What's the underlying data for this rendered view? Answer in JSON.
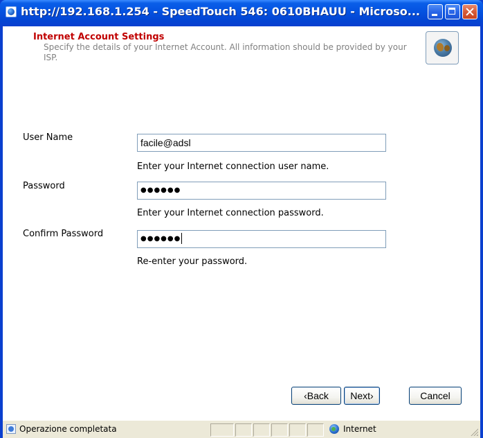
{
  "window": {
    "title": "http://192.168.1.254 - SpeedTouch 546:  0610BHAUU - Microso..."
  },
  "header": {
    "title": "Internet Account Settings",
    "description": "Specify the details of your Internet Account. All information should be provided by your ISP.",
    "icon": "globe-icon"
  },
  "form": {
    "username": {
      "label": "User Name",
      "value": "facile@adsl",
      "hint": "Enter your Internet connection user name."
    },
    "password": {
      "label": "Password",
      "value": "●●●●●●",
      "hint": "Enter your Internet connection password."
    },
    "confirm_password": {
      "label": "Confirm Password",
      "value": "●●●●●●",
      "hint": "Re-enter your password."
    }
  },
  "buttons": {
    "back": "‹Back",
    "next": "Next›",
    "cancel": "Cancel"
  },
  "status_bar": {
    "status": "Operazione completata",
    "zone": "Internet"
  },
  "colors": {
    "title_bar": "#0a5ee8",
    "header_title": "#c00000",
    "description": "#808080"
  }
}
